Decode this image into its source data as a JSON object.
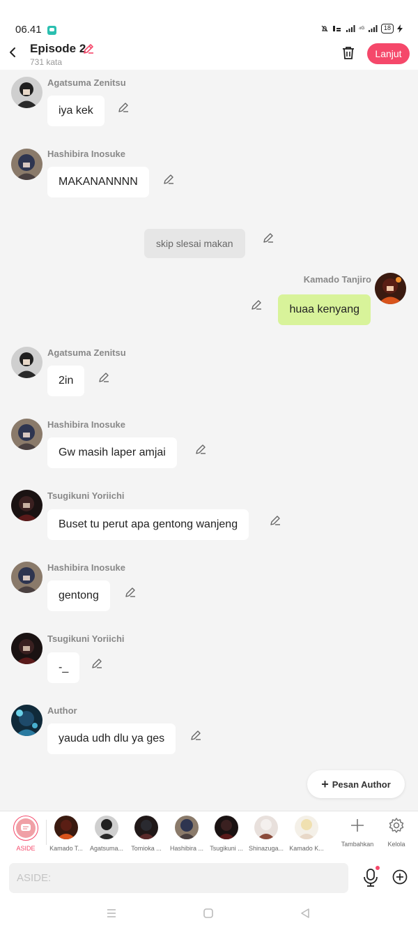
{
  "status_bar": {
    "time": "06.41",
    "signal_text": "⁴ᴳ",
    "battery": "18"
  },
  "header": {
    "title": "Episode 2",
    "word_count": "731 kata",
    "next_label": "Lanjut"
  },
  "messages": [
    {
      "sender": "Agatsuma Zenitsu",
      "text": "iya kek"
    },
    {
      "sender": "Hashibira Inosuke",
      "text": "MAKANANNNN"
    },
    {
      "narration": "skip slesai makan"
    },
    {
      "sender": "Kamado Tanjiro",
      "text": "huaa kenyang"
    },
    {
      "sender": "Agatsuma Zenitsu",
      "text": "2in"
    },
    {
      "sender": "Hashibira Inosuke",
      "text": "Gw masih laper amjai"
    },
    {
      "sender": "Tsugikuni Yoriichi",
      "text": "Buset tu perut apa gentong wanjeng"
    },
    {
      "sender": "Hashibira Inosuke",
      "text": "gentong"
    },
    {
      "sender": "Tsugikuni Yoriichi",
      "text": "-_"
    },
    {
      "sender": "Author",
      "text": "yauda udh dlu ya ges"
    }
  ],
  "author_message_button": "Pesan Author",
  "character_bar": {
    "aside_label": "ASIDE",
    "characters": [
      "Kamado T...",
      "Agatsuma...",
      "Tomioka ...",
      "Hashibira ...",
      "Tsugikuni ...",
      "Shinazuga...",
      "Kamado K..."
    ],
    "add_label": "Tambahkan",
    "manage_label": "Kelola"
  },
  "input": {
    "placeholder": "ASIDE:"
  },
  "colors": {
    "accent": "#f5486a",
    "my_bubble": "#d8f39a",
    "background": "#f4f4f4"
  }
}
